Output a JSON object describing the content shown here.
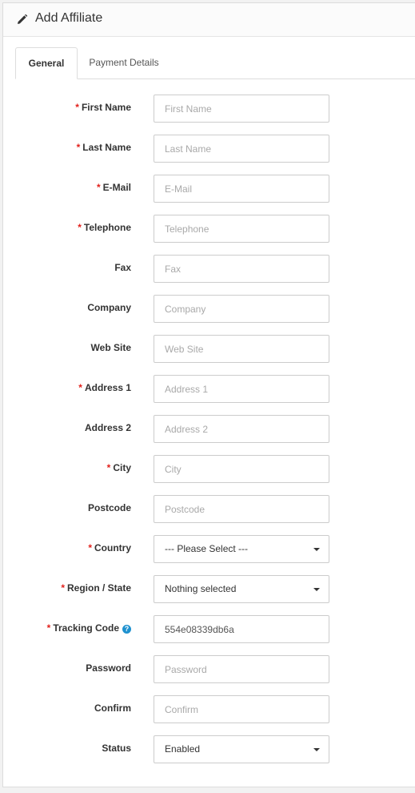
{
  "header": {
    "title": "Add Affiliate",
    "icon": "pencil-icon"
  },
  "tabs": [
    {
      "label": "General",
      "active": true
    },
    {
      "label": "Payment Details",
      "active": false
    }
  ],
  "form": {
    "required_marker": "*",
    "fields": [
      {
        "key": "firstname",
        "label": "First Name",
        "required": true,
        "type": "input",
        "placeholder": "First Name",
        "value": ""
      },
      {
        "key": "lastname",
        "label": "Last Name",
        "required": true,
        "type": "input",
        "placeholder": "Last Name",
        "value": ""
      },
      {
        "key": "email",
        "label": "E-Mail",
        "required": true,
        "type": "input",
        "placeholder": "E-Mail",
        "value": ""
      },
      {
        "key": "telephone",
        "label": "Telephone",
        "required": true,
        "type": "input",
        "placeholder": "Telephone",
        "value": ""
      },
      {
        "key": "fax",
        "label": "Fax",
        "required": false,
        "type": "input",
        "placeholder": "Fax",
        "value": ""
      },
      {
        "key": "company",
        "label": "Company",
        "required": false,
        "type": "input",
        "placeholder": "Company",
        "value": ""
      },
      {
        "key": "website",
        "label": "Web Site",
        "required": false,
        "type": "input",
        "placeholder": "Web Site",
        "value": ""
      },
      {
        "key": "address1",
        "label": "Address 1",
        "required": true,
        "type": "input",
        "placeholder": "Address 1",
        "value": ""
      },
      {
        "key": "address2",
        "label": "Address 2",
        "required": false,
        "type": "input",
        "placeholder": "Address 2",
        "value": ""
      },
      {
        "key": "city",
        "label": "City",
        "required": true,
        "type": "input",
        "placeholder": "City",
        "value": ""
      },
      {
        "key": "postcode",
        "label": "Postcode",
        "required": false,
        "type": "input",
        "placeholder": "Postcode",
        "value": ""
      },
      {
        "key": "country",
        "label": "Country",
        "required": true,
        "type": "select",
        "value": "--- Please Select ---"
      },
      {
        "key": "region",
        "label": "Region / State",
        "required": true,
        "type": "select",
        "value": "Nothing selected"
      },
      {
        "key": "tracking",
        "label": "Tracking Code",
        "required": true,
        "type": "input",
        "placeholder": "",
        "value": "554e08339db6a",
        "help": "?"
      },
      {
        "key": "password",
        "label": "Password",
        "required": false,
        "type": "input",
        "placeholder": "Password",
        "value": ""
      },
      {
        "key": "confirm",
        "label": "Confirm",
        "required": false,
        "type": "input",
        "placeholder": "Confirm",
        "value": ""
      },
      {
        "key": "status",
        "label": "Status",
        "required": false,
        "type": "select",
        "value": "Enabled"
      }
    ]
  },
  "colors": {
    "required": "#e2211c",
    "help": "#1e91cf",
    "border": "#cccccc"
  }
}
